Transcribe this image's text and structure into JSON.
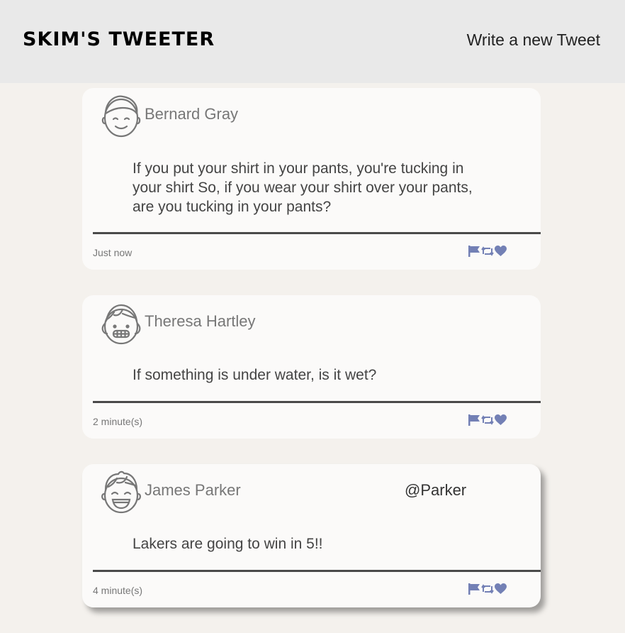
{
  "header": {
    "brand": "SKIM'S TWEETER",
    "write_link": "Write a new Tweet"
  },
  "tweets": [
    {
      "name": "Bernard Gray",
      "handle": "",
      "text": "If you put your shirt in your pants, you're tucking in your shirt So, if you wear your shirt over your pants, are you tucking in your pants?",
      "time": "Just now",
      "avatar_icon": "smiling-face-avatar-icon"
    },
    {
      "name": "Theresa Hartley",
      "handle": "",
      "text": "If something is under water, is it wet?",
      "time": "2 minute(s)",
      "avatar_icon": "grinning-face-avatar-icon"
    },
    {
      "name": "James Parker",
      "handle": "@Parker",
      "text": "Lakers are going to win in 5!!",
      "time": "4 minute(s)",
      "avatar_icon": "laughing-face-avatar-icon"
    }
  ],
  "colors": {
    "action_icon": "#7380b5",
    "page_background": "#f4f1ed",
    "card_background": "#fbfaf9",
    "header_background": "#e9e9e9"
  }
}
